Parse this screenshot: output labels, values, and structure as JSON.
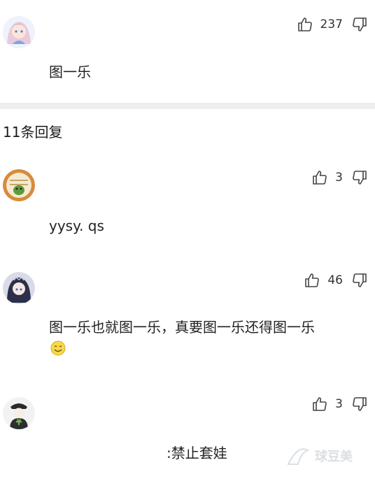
{
  "top_comment": {
    "likes": "237",
    "text": "图一乐"
  },
  "replies_header": "11条回复",
  "replies": [
    {
      "likes": "3",
      "text": "yysy. qs"
    },
    {
      "likes": "46",
      "text": "图一乐也就图一乐，真要图一乐还得图一乐"
    },
    {
      "likes": "3",
      "text": ":禁止套娃"
    }
  ],
  "watermark": "球豆美",
  "icons": {
    "like": "thumbs-up-icon",
    "dislike": "thumbs-down-icon",
    "emoji": "smile-emoji-icon"
  },
  "colors": {
    "divider": "#eeeeee",
    "text": "#222222",
    "icon": "#444444"
  }
}
